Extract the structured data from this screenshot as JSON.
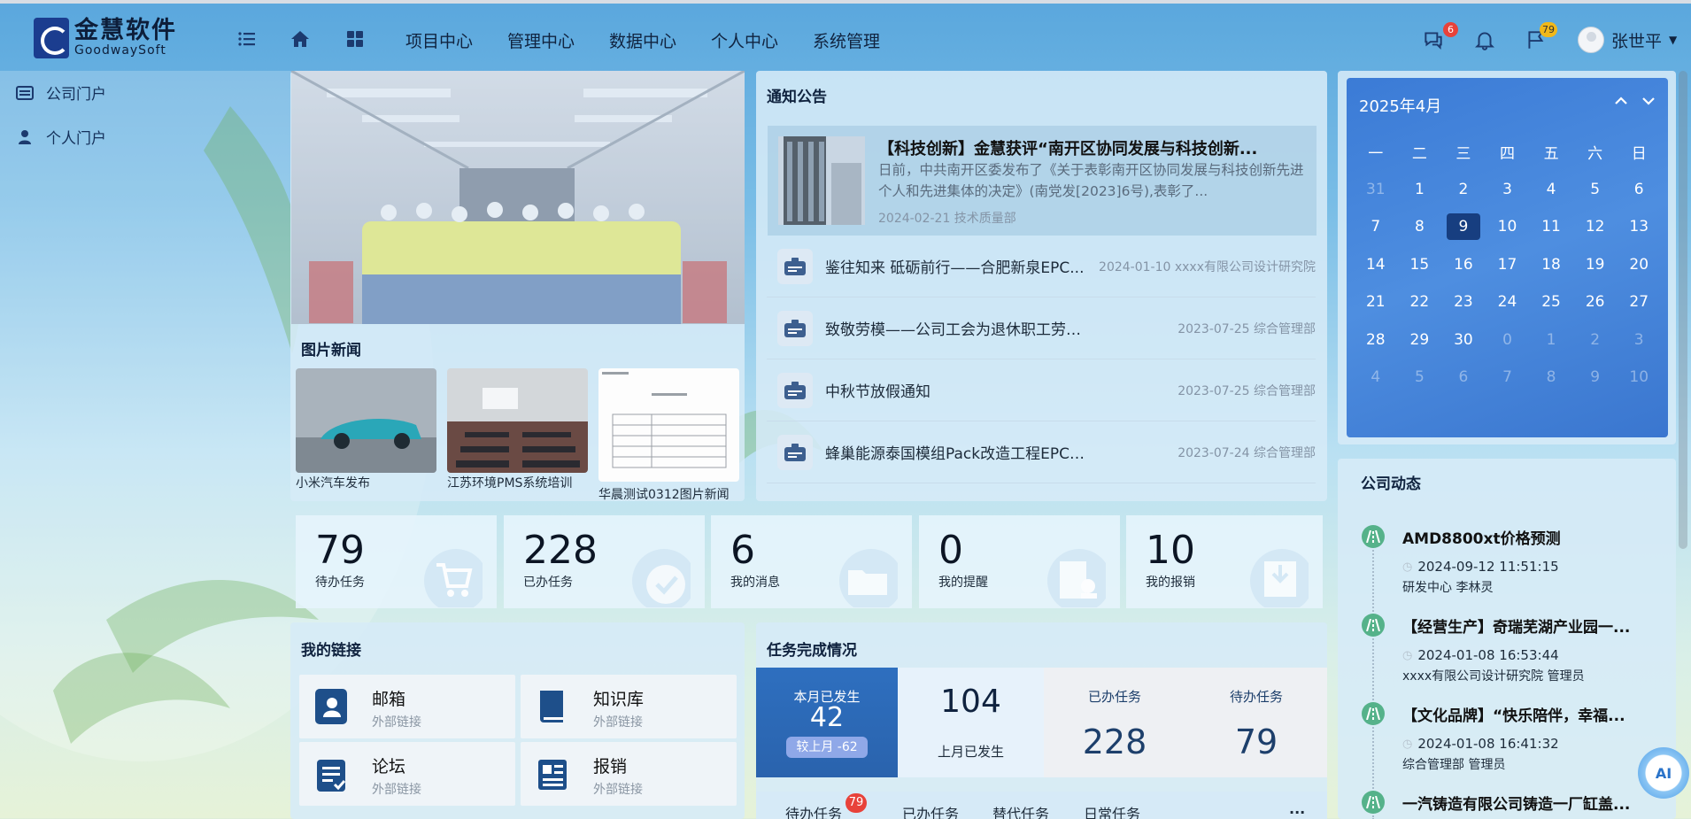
{
  "header": {
    "logo_cn": "金慧软件",
    "logo_en": "GoodwaySoft",
    "menu": [
      "项目中心",
      "管理中心",
      "数据中心",
      "个人中心",
      "系统管理"
    ],
    "messages_badge": "6",
    "flags_badge": "79",
    "user_name": "张世平"
  },
  "sidebar": {
    "items": [
      {
        "label": "公司门户",
        "icon": "list-icon"
      },
      {
        "label": "个人门户",
        "icon": "person-icon"
      }
    ]
  },
  "photo_news": {
    "title": "图片新闻",
    "items": [
      {
        "caption": "小米汽车发布"
      },
      {
        "caption": "江苏环境PMS系统培训"
      },
      {
        "caption": "华晨测试0312图片新闻"
      }
    ]
  },
  "notices": {
    "title": "通知公告",
    "featured": {
      "title": "【科技创新】金慧获评“南开区协同发展与科技创新...",
      "summary": "日前，中共南开区委发布了《关于表彰南开区协同发展与科技创新先进个人和先进集体的决定》(南党发[2023]6号),表彰了...",
      "meta": "2024-02-21 技术质量部"
    },
    "items": [
      {
        "title": "鉴往知来 砥砺前行——合肥新泉EPC...",
        "meta": "2024-01-10 xxxx有限公司设计研究院"
      },
      {
        "title": "致敬劳模——公司工会为退休职工劳动模范送上...",
        "meta": "2023-07-25 综合管理部"
      },
      {
        "title": "中秋节放假通知",
        "meta": "2023-07-25 综合管理部"
      },
      {
        "title": "蜂巢能源泰国模组Pack改造工程EPC总承包项目...",
        "meta": "2023-07-24 综合管理部"
      }
    ]
  },
  "calendar": {
    "title": "2025年4月",
    "weekdays": [
      "一",
      "二",
      "三",
      "四",
      "五",
      "六",
      "日"
    ],
    "days": [
      "31",
      "1",
      "2",
      "3",
      "4",
      "5",
      "6",
      "7",
      "8",
      "9",
      "10",
      "11",
      "12",
      "13",
      "14",
      "15",
      "16",
      "17",
      "18",
      "19",
      "20",
      "21",
      "22",
      "23",
      "24",
      "25",
      "26",
      "27",
      "28",
      "29",
      "30",
      "0",
      "1",
      "2",
      "3",
      "4",
      "5",
      "6",
      "7",
      "8",
      "9",
      "10"
    ],
    "dim_indexes": [
      0,
      31,
      32,
      33,
      34,
      35,
      36,
      37,
      38,
      39,
      40,
      41
    ],
    "today_index": 9
  },
  "stats": [
    {
      "value": "79",
      "label": "待办任务",
      "icon": "cart-icon"
    },
    {
      "value": "228",
      "label": "已办任务",
      "icon": "check-circle-icon"
    },
    {
      "value": "6",
      "label": "我的消息",
      "icon": "folder-icon"
    },
    {
      "value": "0",
      "label": "我的提醒",
      "icon": "document-stamp-icon"
    },
    {
      "value": "10",
      "label": "我的报销",
      "icon": "inbox-download-icon"
    }
  ],
  "links": {
    "title": "我的链接",
    "items": [
      {
        "name": "邮箱",
        "sub": "外部链接",
        "icon": "contact-book-icon"
      },
      {
        "name": "知识库",
        "sub": "外部链接",
        "icon": "book-icon"
      },
      {
        "name": "论坛",
        "sub": "外部链接",
        "icon": "clipboard-check-icon"
      },
      {
        "name": "报销",
        "sub": "外部链接",
        "icon": "newspaper-icon"
      }
    ]
  },
  "task_completion": {
    "title": "任务完成情况",
    "month_label": "本月已发生",
    "month_value": "42",
    "compare_label": "较上月 -62",
    "last_month_value": "104",
    "last_month_label": "上月已发生",
    "done_label": "已办任务",
    "done_value": "228",
    "todo_label": "待办任务",
    "todo_value": "79",
    "tabs": [
      "待办任务",
      "已办任务",
      "替代任务",
      "日常任务"
    ],
    "tab_badge": "79",
    "more": "..."
  },
  "company_feed": {
    "title": "公司动态",
    "items": [
      {
        "title": "AMD8800xt价格预测",
        "time": "2024-09-12 11:51:15",
        "meta": "研发中心   李林灵"
      },
      {
        "title": "【经营生产】奇瑞芜湖产业园一...",
        "time": "2024-01-08 16:53:44",
        "meta": "xxxx有限公司设计研究院   管理员"
      },
      {
        "title": "【文化品牌】“快乐陪伴，幸福...",
        "time": "2024-01-08 16:41:32",
        "meta": "综合管理部   管理员"
      },
      {
        "title": "一汽铸造有限公司铸造一厂缸盖...",
        "time": "",
        "meta": ""
      }
    ]
  },
  "ai_button": "AI"
}
